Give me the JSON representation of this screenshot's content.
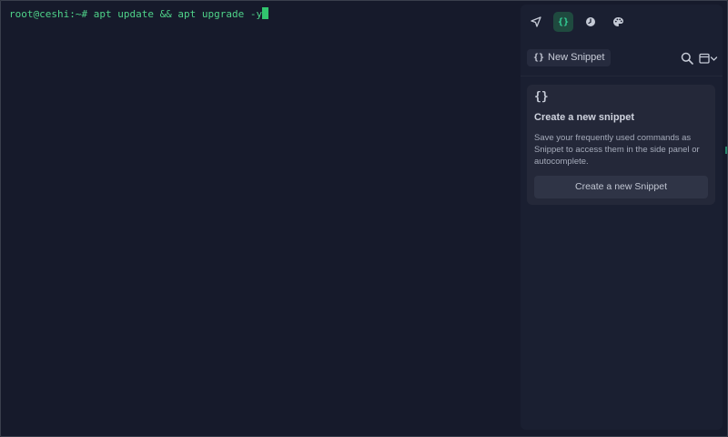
{
  "terminal": {
    "prompt": "root@ceshi:~#",
    "command": " apt update && apt upgrade -y"
  },
  "panel": {
    "tabs": [
      {
        "name": "navigation",
        "icon": "navigation-arrow-icon",
        "label": ""
      },
      {
        "name": "snippets",
        "icon": "braces-icon",
        "label": "{}"
      },
      {
        "name": "history",
        "icon": "clock-icon",
        "label": ""
      },
      {
        "name": "themes",
        "icon": "palette-icon",
        "label": ""
      }
    ],
    "toolbar": {
      "new_snippet_icon": "{}",
      "new_snippet_label": "New Snippet",
      "search_icon": "search-icon",
      "layout_icon": "calendar-dropdown-icon"
    },
    "empty_state": {
      "icon": "{}",
      "title": "Create a new snippet",
      "description": "Save your frequently used commands as Snippet to access them in the side panel or autocomplete.",
      "button_label": "Create a new Snippet"
    }
  },
  "colors": {
    "background": "#161a2b",
    "panel": "#1a1f31",
    "card": "#242839",
    "accent": "#34d399",
    "terminal_text": "#4fd38a"
  }
}
